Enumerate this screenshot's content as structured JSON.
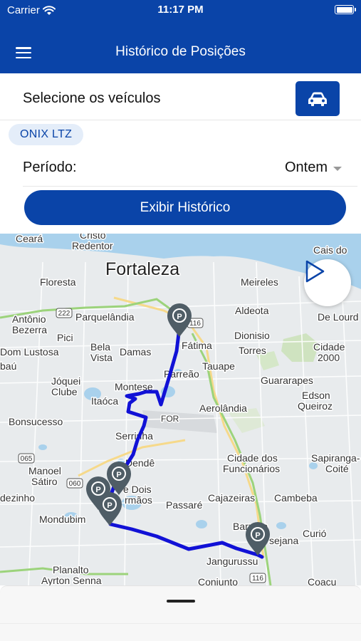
{
  "status_bar": {
    "carrier": "Carrier",
    "time": "11:17 PM"
  },
  "header": {
    "title": "Histórico de Posições"
  },
  "vehicles": {
    "label": "Selecione os veículos",
    "selected": [
      "ONIX LTZ"
    ]
  },
  "period": {
    "label": "Período:",
    "value": "Ontem"
  },
  "actions": {
    "show_history": "Exibir Histórico"
  },
  "map": {
    "labels": {
      "fortaleza": "Fortaleza",
      "ceara": "Ceará",
      "cristo": "Cristo",
      "redentor": "Redentor",
      "cais_do": "Cais do",
      "floresta": "Floresta",
      "meireles": "Meireles",
      "antonio": "Antônio",
      "bezerra": "Bezerra",
      "parquelandia": "Parquelândia",
      "aldeota": "Aldeota",
      "de_lourd": "De Lourd",
      "pici": "Pici",
      "dom_lustosa": "Dom Lustosa",
      "bela": "Bela",
      "vista": "Vista",
      "damas": "Damas",
      "fatima": "Fátima",
      "dionisio": "Dionisio",
      "torres": "Torres",
      "cidade": "Cidade",
      "n2000": "2000",
      "baju": "baú",
      "parreao": "Parreão",
      "tauape": "Tauape",
      "joquei": "Jóquei",
      "clube": "Clube",
      "montese": "Montese",
      "guararapes": "Guararapes",
      "itaoca": "Itaóca",
      "edson": "Edson",
      "queiroz": "Queiroz",
      "aerolandia": "Aerolândia",
      "bonsucesso": "Bonsucesso",
      "for": "FOR",
      "serrinha": "Serrinha",
      "cidade_dos": "Cidade dos",
      "funcionarios": "Funcionários",
      "sapiranga": "Sapiranga-",
      "coite": "Coité",
      "manoel": "Manoel",
      "satiro": "Sátiro",
      "dende": "Dendê",
      "dois": "e Dois",
      "irmaos": "rmãos",
      "cajazeiras": "Cajazeiras",
      "cambeba": "Cambeba",
      "dezinho": "dezinho",
      "mondubim": "Mondubim",
      "passare": "Passaré",
      "barroso": "Barroso",
      "curio": "Curió",
      "sejana": "sejana",
      "planalto": "Planalto",
      "ayrton": "Ayrton Senna",
      "jangurussu": "Jangurussu",
      "conjunto": "Conjunto",
      "coacu": "Coaçu",
      "r116a": "116",
      "r116b": "116",
      "r222": "222",
      "r065": "065",
      "r060": "060",
      "parking": "P"
    }
  },
  "colors": {
    "primary": "#0a44a8",
    "route": "#1111d6",
    "marker": "#4f5d66",
    "chip_bg": "#e4edf9"
  },
  "icons": [
    "wifi-icon",
    "battery-icon",
    "menu-icon",
    "car-icon",
    "chevron-down-icon",
    "play-icon",
    "parking-marker-icon"
  ]
}
